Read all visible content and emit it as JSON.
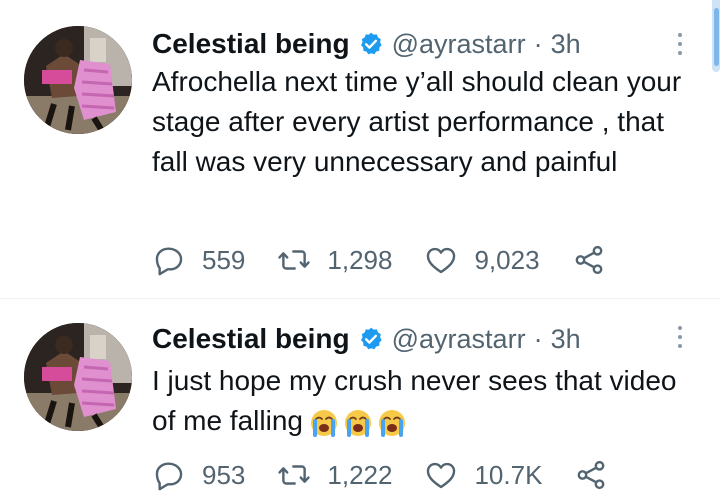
{
  "tweets": [
    {
      "name": "Celestial being",
      "handle": "@ayrastarr",
      "separator": "·",
      "time": "3h",
      "text": "Afrochella next time y’all should clean your stage after every artist performance , that fall was very unnecessary and painful",
      "emoji_count": 0,
      "replies": "559",
      "retweets": "1,298",
      "likes": "9,023"
    },
    {
      "name": "Celestial being",
      "handle": "@ayrastarr",
      "separator": "·",
      "time": "3h",
      "text": "I just hope my crush never sees that video of me falling",
      "emoji_count": 3,
      "replies": "953",
      "retweets": "1,222",
      "likes": "10.7K"
    }
  ],
  "icons": {
    "verified": "verified-badge-icon",
    "more": "more-vertical-icon",
    "reply": "reply-bubble-icon",
    "retweet": "retweet-icon",
    "like": "heart-icon",
    "share": "share-icon",
    "emoji": "loudly-crying-face-emoji"
  },
  "colors": {
    "text": "#0f1419",
    "secondary": "#536471",
    "verified": "#1d9bf0",
    "divider": "#eff3f4"
  }
}
